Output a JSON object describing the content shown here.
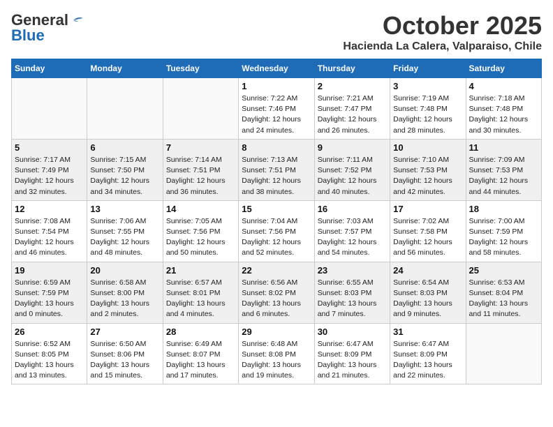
{
  "header": {
    "logo_general": "General",
    "logo_blue": "Blue",
    "month": "October 2025",
    "location": "Hacienda La Calera, Valparaiso, Chile"
  },
  "weekdays": [
    "Sunday",
    "Monday",
    "Tuesday",
    "Wednesday",
    "Thursday",
    "Friday",
    "Saturday"
  ],
  "weeks": [
    [
      {
        "day": "",
        "info": ""
      },
      {
        "day": "",
        "info": ""
      },
      {
        "day": "",
        "info": ""
      },
      {
        "day": "1",
        "info": "Sunrise: 7:22 AM\nSunset: 7:46 PM\nDaylight: 12 hours\nand 24 minutes."
      },
      {
        "day": "2",
        "info": "Sunrise: 7:21 AM\nSunset: 7:47 PM\nDaylight: 12 hours\nand 26 minutes."
      },
      {
        "day": "3",
        "info": "Sunrise: 7:19 AM\nSunset: 7:48 PM\nDaylight: 12 hours\nand 28 minutes."
      },
      {
        "day": "4",
        "info": "Sunrise: 7:18 AM\nSunset: 7:48 PM\nDaylight: 12 hours\nand 30 minutes."
      }
    ],
    [
      {
        "day": "5",
        "info": "Sunrise: 7:17 AM\nSunset: 7:49 PM\nDaylight: 12 hours\nand 32 minutes."
      },
      {
        "day": "6",
        "info": "Sunrise: 7:15 AM\nSunset: 7:50 PM\nDaylight: 12 hours\nand 34 minutes."
      },
      {
        "day": "7",
        "info": "Sunrise: 7:14 AM\nSunset: 7:51 PM\nDaylight: 12 hours\nand 36 minutes."
      },
      {
        "day": "8",
        "info": "Sunrise: 7:13 AM\nSunset: 7:51 PM\nDaylight: 12 hours\nand 38 minutes."
      },
      {
        "day": "9",
        "info": "Sunrise: 7:11 AM\nSunset: 7:52 PM\nDaylight: 12 hours\nand 40 minutes."
      },
      {
        "day": "10",
        "info": "Sunrise: 7:10 AM\nSunset: 7:53 PM\nDaylight: 12 hours\nand 42 minutes."
      },
      {
        "day": "11",
        "info": "Sunrise: 7:09 AM\nSunset: 7:53 PM\nDaylight: 12 hours\nand 44 minutes."
      }
    ],
    [
      {
        "day": "12",
        "info": "Sunrise: 7:08 AM\nSunset: 7:54 PM\nDaylight: 12 hours\nand 46 minutes."
      },
      {
        "day": "13",
        "info": "Sunrise: 7:06 AM\nSunset: 7:55 PM\nDaylight: 12 hours\nand 48 minutes."
      },
      {
        "day": "14",
        "info": "Sunrise: 7:05 AM\nSunset: 7:56 PM\nDaylight: 12 hours\nand 50 minutes."
      },
      {
        "day": "15",
        "info": "Sunrise: 7:04 AM\nSunset: 7:56 PM\nDaylight: 12 hours\nand 52 minutes."
      },
      {
        "day": "16",
        "info": "Sunrise: 7:03 AM\nSunset: 7:57 PM\nDaylight: 12 hours\nand 54 minutes."
      },
      {
        "day": "17",
        "info": "Sunrise: 7:02 AM\nSunset: 7:58 PM\nDaylight: 12 hours\nand 56 minutes."
      },
      {
        "day": "18",
        "info": "Sunrise: 7:00 AM\nSunset: 7:59 PM\nDaylight: 12 hours\nand 58 minutes."
      }
    ],
    [
      {
        "day": "19",
        "info": "Sunrise: 6:59 AM\nSunset: 7:59 PM\nDaylight: 13 hours\nand 0 minutes."
      },
      {
        "day": "20",
        "info": "Sunrise: 6:58 AM\nSunset: 8:00 PM\nDaylight: 13 hours\nand 2 minutes."
      },
      {
        "day": "21",
        "info": "Sunrise: 6:57 AM\nSunset: 8:01 PM\nDaylight: 13 hours\nand 4 minutes."
      },
      {
        "day": "22",
        "info": "Sunrise: 6:56 AM\nSunset: 8:02 PM\nDaylight: 13 hours\nand 6 minutes."
      },
      {
        "day": "23",
        "info": "Sunrise: 6:55 AM\nSunset: 8:03 PM\nDaylight: 13 hours\nand 7 minutes."
      },
      {
        "day": "24",
        "info": "Sunrise: 6:54 AM\nSunset: 8:03 PM\nDaylight: 13 hours\nand 9 minutes."
      },
      {
        "day": "25",
        "info": "Sunrise: 6:53 AM\nSunset: 8:04 PM\nDaylight: 13 hours\nand 11 minutes."
      }
    ],
    [
      {
        "day": "26",
        "info": "Sunrise: 6:52 AM\nSunset: 8:05 PM\nDaylight: 13 hours\nand 13 minutes."
      },
      {
        "day": "27",
        "info": "Sunrise: 6:50 AM\nSunset: 8:06 PM\nDaylight: 13 hours\nand 15 minutes."
      },
      {
        "day": "28",
        "info": "Sunrise: 6:49 AM\nSunset: 8:07 PM\nDaylight: 13 hours\nand 17 minutes."
      },
      {
        "day": "29",
        "info": "Sunrise: 6:48 AM\nSunset: 8:08 PM\nDaylight: 13 hours\nand 19 minutes."
      },
      {
        "day": "30",
        "info": "Sunrise: 6:47 AM\nSunset: 8:09 PM\nDaylight: 13 hours\nand 21 minutes."
      },
      {
        "day": "31",
        "info": "Sunrise: 6:47 AM\nSunset: 8:09 PM\nDaylight: 13 hours\nand 22 minutes."
      },
      {
        "day": "",
        "info": ""
      }
    ]
  ]
}
